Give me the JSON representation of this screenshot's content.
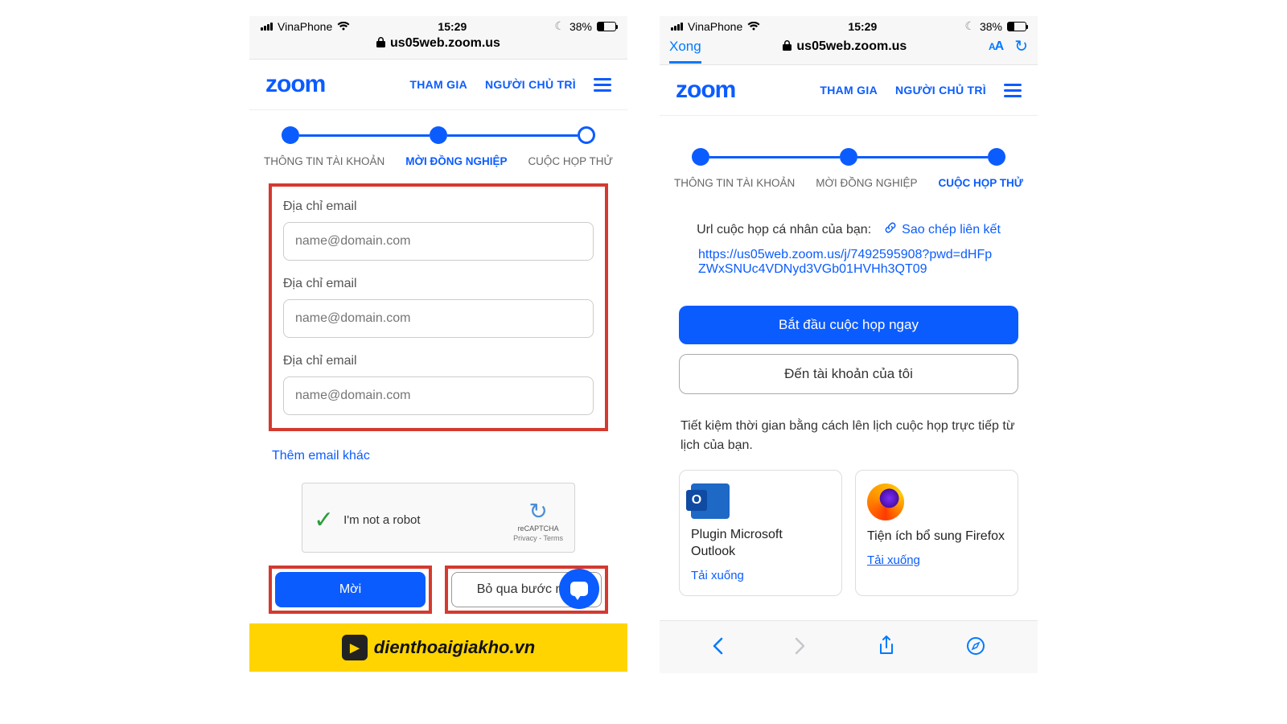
{
  "status_bar": {
    "carrier": "VinaPhone",
    "time": "15:29",
    "battery_pct": "38%",
    "moon": "☾"
  },
  "browser": {
    "url": "us05web.zoom.us",
    "done_label": "Xong",
    "aa_label": "AA"
  },
  "zoom_header": {
    "logo": "zoom",
    "join": "THAM GIA",
    "host": "NGƯỜI CHỦ TRÌ"
  },
  "steps": {
    "s1": "THÔNG TIN TÀI KHOẢN",
    "s2": "MỜI ĐỒNG NGHIỆP",
    "s3": "CUỘC HỌP THỬ"
  },
  "left": {
    "email_label": "Địa chỉ email",
    "email_placeholder": "name@domain.com",
    "add_more": "Thêm email khác",
    "recaptcha_text": "I'm not a robot",
    "recaptcha_brand": "reCAPTCHA",
    "recaptcha_links": "Privacy - Terms",
    "invite_btn": "Mời",
    "skip_btn": "Bỏ qua bước này",
    "footer_site": "dienthoaigiakho.vn"
  },
  "right": {
    "url_label": "Url cuộc họp cá nhân của bạn:",
    "copy_link": "Sao chép liên kết",
    "meeting_url": "https://us05web.zoom.us/j/7492595908?pwd=dHFpZWxSNUc4VDNyd3VGb01HVHh3QT09",
    "start_btn": "Bắt đầu cuộc họp ngay",
    "account_btn": "Đến tài khoản của tôi",
    "hint": "Tiết kiệm thời gian bằng cách lên lịch cuộc họp trực tiếp từ lịch của bạn.",
    "cards": {
      "outlook_title": "Plugin Microsoft Outlook",
      "firefox_title": "Tiện ích bổ sung Firefox",
      "download": "Tải xuống"
    }
  }
}
